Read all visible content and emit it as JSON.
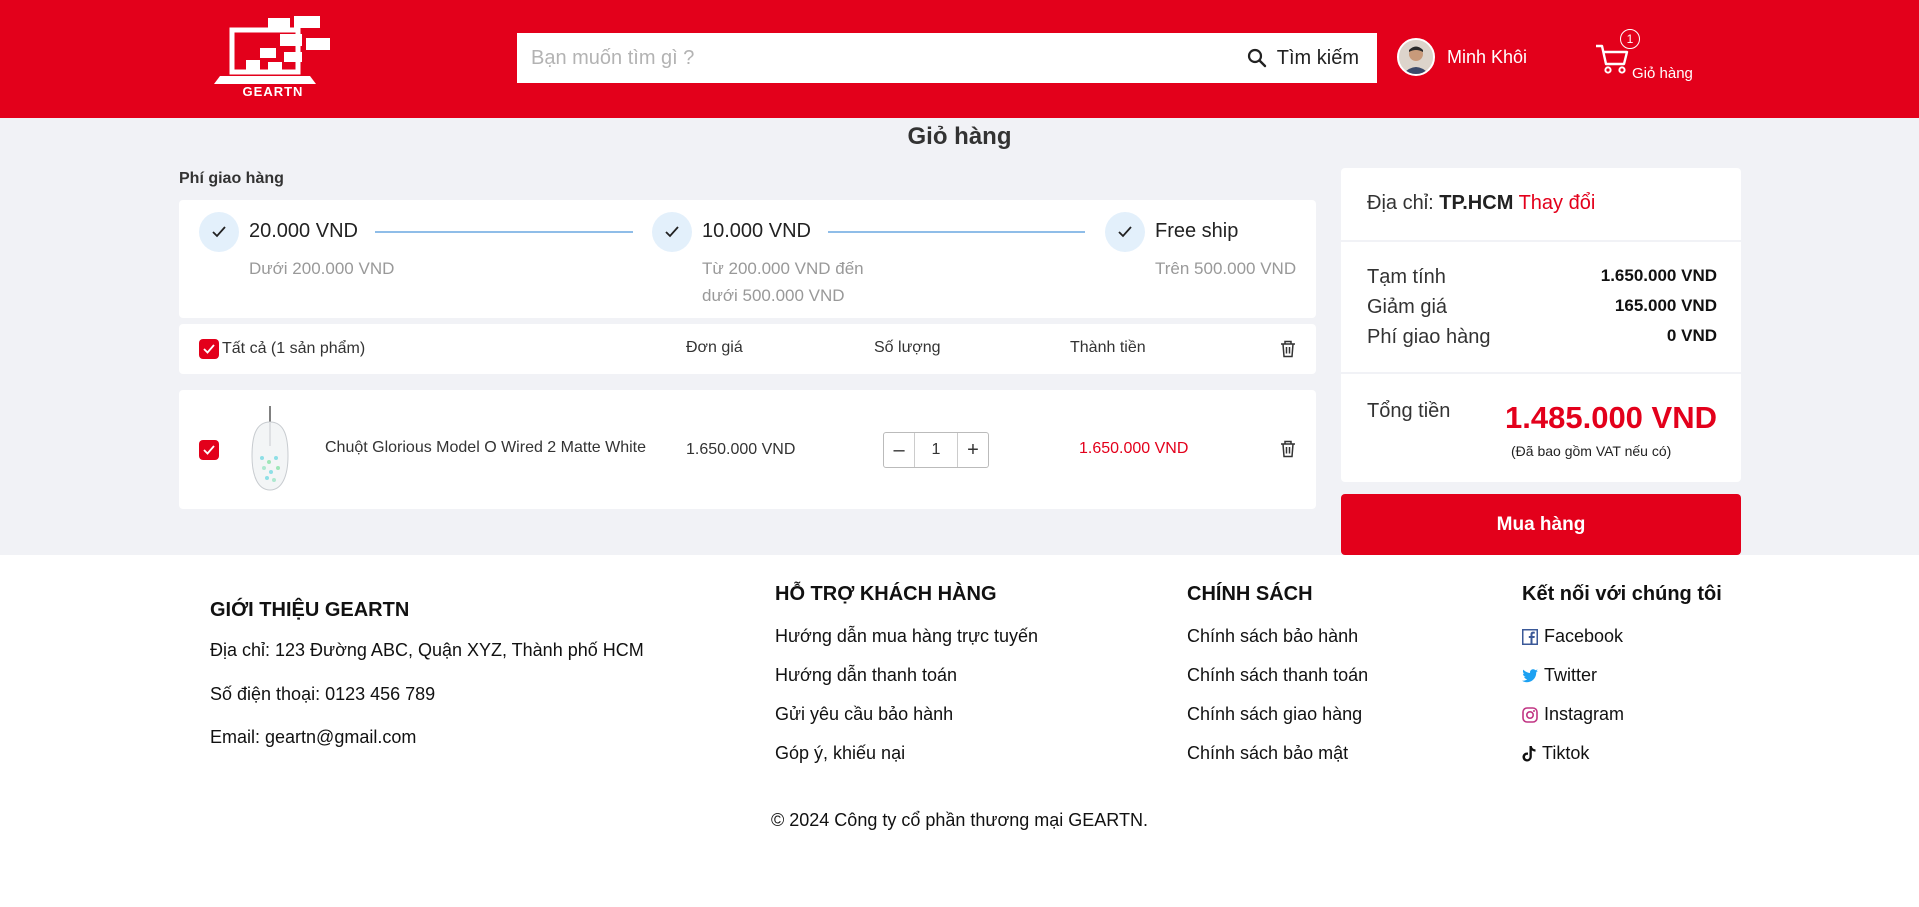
{
  "header": {
    "logo_text": "GEARTN",
    "search_placeholder": "Bạn muốn tìm gì ?",
    "search_button": "Tìm kiếm",
    "user_name": "Minh Khôi",
    "cart_count": "1",
    "cart_label": "Giỏ hàng"
  },
  "page": {
    "title": "Giỏ hàng",
    "shipping_title": "Phí giao hàng"
  },
  "shipping_steps": [
    {
      "title": "20.000 VND",
      "desc_1": "Dưới 200.000 VND",
      "desc_2": ""
    },
    {
      "title": "10.000 VND",
      "desc_1": "Từ 200.000 VND đến",
      "desc_2": "dưới 500.000 VND"
    },
    {
      "title": "Free ship",
      "desc_1": "Trên 500.000 VND",
      "desc_2": ""
    }
  ],
  "cart_table": {
    "select_all": "Tất cả (1 sản phẩm)",
    "col_price": "Đơn giá",
    "col_qty": "Số lượng",
    "col_total": "Thành tiền"
  },
  "cart_items": [
    {
      "name": "Chuột Glorious Model O Wired 2 Matte White",
      "price": "1.650.000 VND",
      "qty": "1",
      "total": "1.650.000 VND"
    }
  ],
  "summary": {
    "address_label": "Địa chỉ:",
    "address_value": "TP.HCM",
    "address_change": "Thay đổi",
    "subtotal_label": "Tạm tính",
    "subtotal_value": "1.650.000 VND",
    "discount_label": "Giảm giá",
    "discount_value": "165.000 VND",
    "shipping_label": "Phí giao hàng",
    "shipping_value": "0 VND",
    "total_label": "Tổng tiền",
    "total_value": "1.485.000 VND",
    "vat_note": "(Đã bao gồm VAT nếu có)",
    "buy_button": "Mua hàng"
  },
  "footer": {
    "about_title": "GIỚI THIỆU GEARTN",
    "about_address": "Địa chỉ: 123 Đường ABC, Quận XYZ, Thành phố HCM",
    "about_phone": "Số điện thoại: 0123 456 789",
    "about_email": "Email: geartn@gmail.com",
    "support_title": "HỖ TRỢ KHÁCH HÀNG",
    "support_links": [
      "Hướng dẫn mua hàng trực tuyến",
      "Hướng dẫn thanh toán",
      "Gửi yêu cầu bảo hành",
      "Góp ý, khiếu nại"
    ],
    "policy_title": "CHÍNH SÁCH",
    "policy_links": [
      "Chính sách bảo hành",
      "Chính sách thanh toán",
      "Chính sách giao hàng",
      "Chính sách bảo mật"
    ],
    "connect_title": "Kết nối với chúng tôi",
    "social_links": [
      "Facebook",
      "Twitter",
      "Instagram",
      "Tiktok"
    ],
    "copyright": "© 2024 Công ty cổ phần thương mại GEARTN."
  },
  "colors": {
    "brand": "#e3001b",
    "background": "#f1f2f6",
    "step_line": "#8fbde8"
  },
  "icons": [
    "laptop-logo",
    "search-icon",
    "cart-icon",
    "check-icon",
    "trash-icon",
    "facebook-icon",
    "twitter-icon",
    "instagram-icon",
    "tiktok-icon"
  ]
}
